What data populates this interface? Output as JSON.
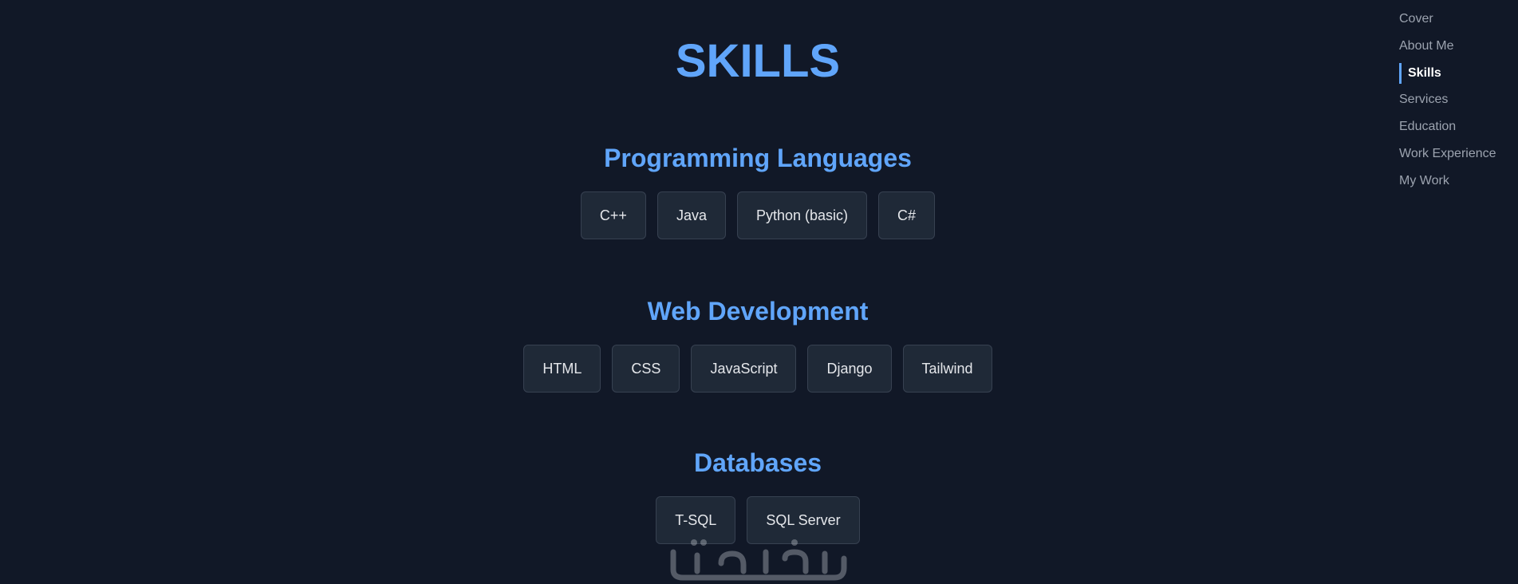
{
  "page": {
    "title": "SKILLS"
  },
  "sections": [
    {
      "title": "Programming Languages",
      "skills": [
        "C++",
        "Java",
        "Python (basic)",
        "C#"
      ]
    },
    {
      "title": "Web Development",
      "skills": [
        "HTML",
        "CSS",
        "JavaScript",
        "Django",
        "Tailwind"
      ]
    },
    {
      "title": "Databases",
      "skills": [
        "T-SQL",
        "SQL Server"
      ]
    }
  ],
  "nav": {
    "items": [
      "Cover",
      "About Me",
      "Skills",
      "Services",
      "Education",
      "Work Experience",
      "My Work"
    ],
    "active": "Skills"
  },
  "colors": {
    "background": "#111827",
    "accent": "#60a5fa",
    "chip_bg": "#1f2937",
    "chip_border": "#374151",
    "nav_text": "#9ca3af",
    "nav_active": "#ffffff"
  },
  "watermark": {
    "icon": "khamsat-logo-watermark"
  }
}
